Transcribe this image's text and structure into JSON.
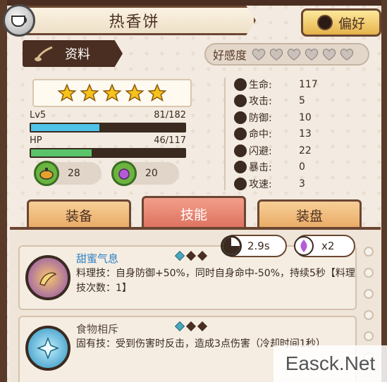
{
  "header": {
    "title": "热香饼",
    "pref_label": "偏好"
  },
  "info_tab": {
    "label": "资料"
  },
  "favor": {
    "label": "好感度",
    "hearts_total": 6,
    "hearts_filled": 0
  },
  "stars": {
    "count": 5
  },
  "level": {
    "label": "Lv5",
    "value": "81/182",
    "fraction": 0.445
  },
  "hp": {
    "label": "HP",
    "value": "46/117",
    "fraction": 0.393
  },
  "resources": [
    {
      "name": "cooking-pot",
      "value": "28"
    },
    {
      "name": "purple-drop",
      "value": "20"
    }
  ],
  "stats": [
    {
      "label": "生命:",
      "value": "117",
      "icon": "heart-icon"
    },
    {
      "label": "攻击:",
      "value": "5",
      "icon": "sword-icon"
    },
    {
      "label": "防御:",
      "value": "10",
      "icon": "shield-icon"
    },
    {
      "label": "命中:",
      "value": "13",
      "icon": "crosshair-icon"
    },
    {
      "label": "闪避:",
      "value": "22",
      "icon": "dodge-icon"
    },
    {
      "label": "暴击:",
      "value": "0",
      "icon": "crit-icon"
    },
    {
      "label": "攻速:",
      "value": "3",
      "icon": "lightning-icon"
    }
  ],
  "tabs": [
    {
      "label": "装备"
    },
    {
      "label": "技能"
    },
    {
      "label": "装盘"
    }
  ],
  "badges": {
    "time": "2.9s",
    "multiplier": "x2"
  },
  "skills": [
    {
      "name": "甜蜜气息",
      "desc": "料理技：自身防御+50%，同时自身命中-50%，持续5秒【料理技次数：1】"
    },
    {
      "name": "食物相斥",
      "desc": "固有技：受到伤害时反击，造成3点伤害（冷却时间1秒）"
    }
  ],
  "colors": {
    "skill_name_1": "#2f7fc2",
    "skill_name_2": "#5a4a40",
    "level_bar": "#4fc3e8",
    "hp_bar": "#5ac46a"
  },
  "watermark": "Easck.Net"
}
